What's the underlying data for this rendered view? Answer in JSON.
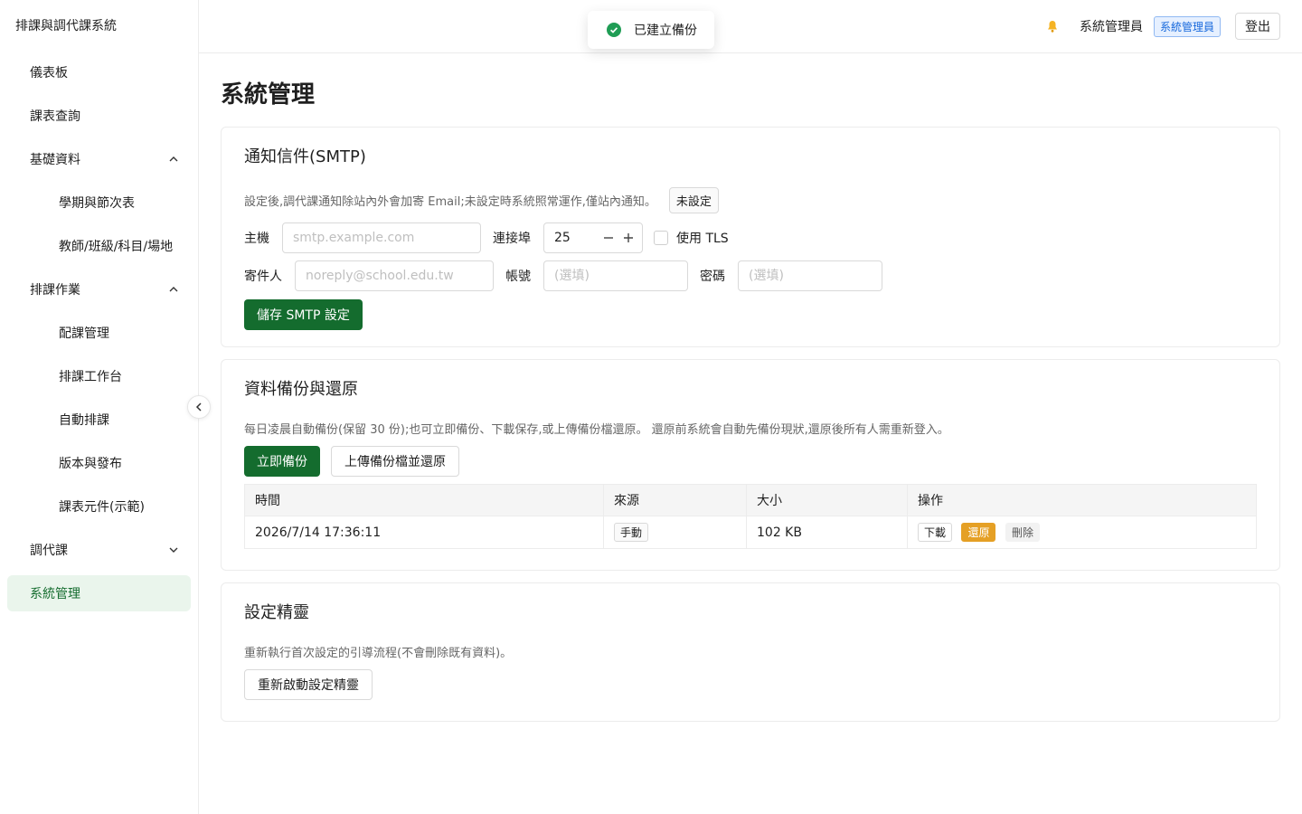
{
  "app": {
    "title": "排課與調代課系統"
  },
  "sidebar": {
    "items": [
      {
        "label": "儀表板"
      },
      {
        "label": "課表查詢"
      },
      {
        "label": "基礎資料",
        "expanded": true
      },
      {
        "label": "學期與節次表"
      },
      {
        "label": "教師/班級/科目/場地"
      },
      {
        "label": "排課作業",
        "expanded": true
      },
      {
        "label": "配課管理"
      },
      {
        "label": "排課工作台"
      },
      {
        "label": "自動排課"
      },
      {
        "label": "版本與發布"
      },
      {
        "label": "課表元件(示範)"
      },
      {
        "label": "調代課",
        "expanded": false
      },
      {
        "label": "系統管理",
        "active": true
      }
    ]
  },
  "header": {
    "username": "系統管理員",
    "role_badge": "系統管理員",
    "logout_label": "登出"
  },
  "toast": {
    "message": "已建立備份"
  },
  "page": {
    "title": "系統管理"
  },
  "smtp": {
    "title": "通知信件(SMTP)",
    "description": "設定後,調代課通知除站內外會加寄 Email;未設定時系統照常運作,僅站內通知。",
    "status": "未設定",
    "host_label": "主機",
    "host_placeholder": "smtp.example.com",
    "port_label": "連接埠",
    "port_value": "25",
    "tls_label": "使用 TLS",
    "sender_label": "寄件人",
    "sender_placeholder": "noreply@school.edu.tw",
    "account_label": "帳號",
    "account_placeholder": "(選填)",
    "password_label": "密碼",
    "password_placeholder": "(選填)",
    "save_label": "儲存 SMTP 設定"
  },
  "backup": {
    "title": "資料備份與還原",
    "description": "每日凌晨自動備份(保留 30 份);也可立即備份、下載保存,或上傳備份檔還原。 還原前系統會自動先備份現狀,還原後所有人需重新登入。",
    "backup_now_label": "立即備份",
    "upload_label": "上傳備份檔並還原",
    "columns": [
      "時間",
      "來源",
      "大小",
      "操作"
    ],
    "rows": [
      {
        "time": "2026/7/14 17:36:11",
        "source": "手動",
        "size": "102 KB",
        "download": "下載",
        "restore": "還原",
        "delete": "刪除"
      }
    ]
  },
  "wizard": {
    "title": "設定精靈",
    "description": "重新執行首次設定的引導流程(不會刪除既有資料)。",
    "restart_label": "重新啟動設定精靈"
  },
  "colors": {
    "primary": "#146c2e",
    "active_bg": "#eaf5ec",
    "restore": "#e5a025",
    "badge": "#1668dc"
  }
}
